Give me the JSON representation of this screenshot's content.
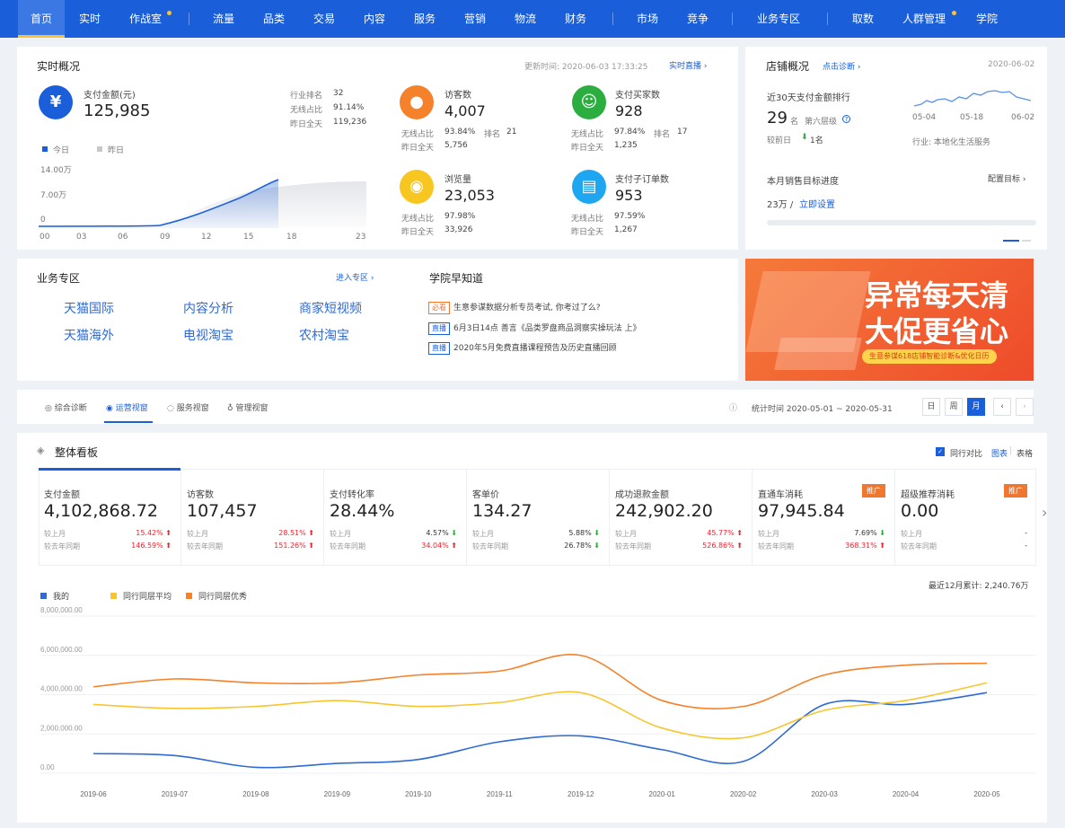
{
  "nav": {
    "items": [
      "首页",
      "实时",
      "作战室",
      "流量",
      "品类",
      "交易",
      "内容",
      "服务",
      "营销",
      "物流",
      "财务",
      "市场",
      "竞争",
      "业务专区",
      "取数",
      "人群管理",
      "学院"
    ]
  },
  "realtime": {
    "title": "实时概况",
    "update_time": "更新时间: 2020-06-03 17:33:25",
    "live_link": "实时直播 ›",
    "pay": {
      "icon": "yen-icon",
      "label": "支付金额(元)",
      "value": "125,985",
      "rank_label": "行业排名",
      "rank_value": "32",
      "wireless_label": "无线占比",
      "wireless_value": "91.14%",
      "yesterday_label": "昨日全天",
      "yesterday_value": "119,236"
    },
    "legend_today": "今日",
    "legend_yesterday": "昨日",
    "y_ticks": [
      "14.00万",
      "7.00万",
      "0"
    ],
    "x_ticks": [
      "00",
      "03",
      "06",
      "09",
      "12",
      "15",
      "18",
      "23"
    ],
    "kpis": [
      {
        "icon": "footprint-icon",
        "label": "访客数",
        "value": "4,007",
        "r1_label": "无线占比",
        "r1_value": "93.84%",
        "r1_extra_label": "排名",
        "r1_extra_value": "21",
        "r2_label": "昨日全天",
        "r2_value": "5,756"
      },
      {
        "icon": "users-icon",
        "label": "支付买家数",
        "value": "928",
        "r1_label": "无线占比",
        "r1_value": "97.84%",
        "r1_extra_label": "排名",
        "r1_extra_value": "17",
        "r2_label": "昨日全天",
        "r2_value": "1,235"
      },
      {
        "icon": "eye-icon",
        "label": "浏览量",
        "value": "23,053",
        "r1_label": "无线占比",
        "r1_value": "97.98%",
        "r1_extra_label": "",
        "r1_extra_value": "",
        "r2_label": "昨日全天",
        "r2_value": "33,926"
      },
      {
        "icon": "clipboard-icon",
        "label": "支付子订单数",
        "value": "953",
        "r1_label": "无线占比",
        "r1_value": "97.59%",
        "r1_extra_label": "",
        "r1_extra_value": "",
        "r2_label": "昨日全天",
        "r2_value": "1,267"
      }
    ],
    "colors": {
      "pay": "#1a5fd9",
      "visitors": "#f5822a",
      "buyers": "#2bad40",
      "views": "#f7c621",
      "orders": "#1ea7f0"
    }
  },
  "store": {
    "title": "店铺概况",
    "diag_link": "点击诊断 ›",
    "date": "2020-06-02",
    "rank_title": "近30天支付金额排行",
    "rank_value": "29",
    "rank_unit": "名",
    "tier": "第六层级",
    "compare_label": "较前日",
    "compare_value": "1名",
    "spark_ticks": [
      "05-04",
      "05-18",
      "06-02"
    ],
    "industry": "行业: 本地化生活服务",
    "goal_title": "本月销售目标进度",
    "goal_link": "配置目标 ›",
    "goal_amount": "23万 /",
    "goal_set": "立即设置"
  },
  "business": {
    "title": "业务专区",
    "enter": "进入专区 ›",
    "links": [
      "天猫国际",
      "内容分析",
      "商家短视频",
      "天猫海外",
      "电视淘宝",
      "农村淘宝"
    ]
  },
  "academy": {
    "title": "学院早知道",
    "items": [
      {
        "tag": "必看",
        "text": "生意参谋数据分析专员考试, 你考过了么?"
      },
      {
        "tag": "直播",
        "text": "6月3日14点 善言《品类罗盘商品洞察实操玩法 上》"
      },
      {
        "tag": "直播",
        "text": "2020年5月免费直播课程预告及历史直播回顾"
      }
    ]
  },
  "banner": {
    "line1": "异常每天清",
    "line2": "大促更省心",
    "sub": "生意参谋618店铺智能诊断&优化日历"
  },
  "tabs": {
    "items": [
      "综合诊断",
      "运营视窗",
      "服务视窗",
      "管理视窗"
    ],
    "active": 1,
    "stat_time": "统计时间 2020-05-01 ~ 2020-05-31",
    "periods": [
      "日",
      "周",
      "月"
    ],
    "prev": "‹",
    "next": "›"
  },
  "dashboard": {
    "title": "整体看板",
    "peer_label": "同行对比",
    "view_chart": "图表",
    "view_table": "表格",
    "more_arrow": "›",
    "metrics": [
      {
        "label": "支付金额",
        "value": "4,102,868.72",
        "r1": "较上月",
        "p1": "15.42%",
        "d1": "up",
        "r2": "较去年同期",
        "p2": "146.59%",
        "d2": "up",
        "badge": ""
      },
      {
        "label": "访客数",
        "value": "107,457",
        "r1": "较上月",
        "p1": "28.51%",
        "d1": "up",
        "r2": "较去年同期",
        "p2": "151.26%",
        "d2": "up",
        "badge": ""
      },
      {
        "label": "支付转化率",
        "value": "28.44%",
        "r1": "较上月",
        "p1": "4.57%",
        "d1": "down",
        "r2": "较去年同期",
        "p2": "34.04%",
        "d2": "up",
        "badge": ""
      },
      {
        "label": "客单价",
        "value": "134.27",
        "r1": "较上月",
        "p1": "5.88%",
        "d1": "down",
        "r2": "较去年同期",
        "p2": "26.78%",
        "d2": "down",
        "badge": ""
      },
      {
        "label": "成功退款金额",
        "value": "242,902.20",
        "r1": "较上月",
        "p1": "45.77%",
        "d1": "up",
        "r2": "较去年同期",
        "p2": "526.86%",
        "d2": "up",
        "badge": ""
      },
      {
        "label": "直通车消耗",
        "value": "97,945.84",
        "r1": "较上月",
        "p1": "7.69%",
        "d1": "down",
        "r2": "较去年同期",
        "p2": "368.31%",
        "d2": "up",
        "badge": "推广"
      },
      {
        "label": "超级推荐消耗",
        "value": "0.00",
        "r1": "较上月",
        "p1": "-",
        "d1": "none",
        "r2": "较去年同期",
        "p2": "-",
        "d2": "none",
        "badge": "推广"
      }
    ],
    "cumulative": "最近12月累计: 2,240.76万"
  },
  "chart_data": {
    "type": "line",
    "x": [
      "2019-06",
      "2019-07",
      "2019-08",
      "2019-09",
      "2019-10",
      "2019-11",
      "2019-12",
      "2020-01",
      "2020-02",
      "2020-03",
      "2020-04",
      "2020-05"
    ],
    "series": [
      {
        "name": "我的",
        "color": "#2f6bd3",
        "values": [
          1000000,
          900000,
          300000,
          500000,
          700000,
          1600000,
          1900000,
          1200000,
          600000,
          3500000,
          3500000,
          4100000
        ]
      },
      {
        "name": "同行同层平均",
        "color": "#f7c52d",
        "values": [
          3500000,
          3300000,
          3400000,
          3700000,
          3400000,
          3600000,
          4100000,
          2300000,
          1800000,
          3200000,
          3700000,
          4600000
        ]
      },
      {
        "name": "同行同层优秀",
        "color": "#f5822a",
        "values": [
          4400000,
          4800000,
          4600000,
          4600000,
          5000000,
          5200000,
          6000000,
          3700000,
          3400000,
          5000000,
          5500000,
          5600000
        ]
      }
    ],
    "y_ticks": [
      "8,000,000.00",
      "6,000,000.00",
      "4,000,000.00",
      "2,000,000.00",
      "0.00"
    ],
    "ylim": [
      0,
      8000000
    ],
    "grid": true,
    "legend": "top-left"
  }
}
